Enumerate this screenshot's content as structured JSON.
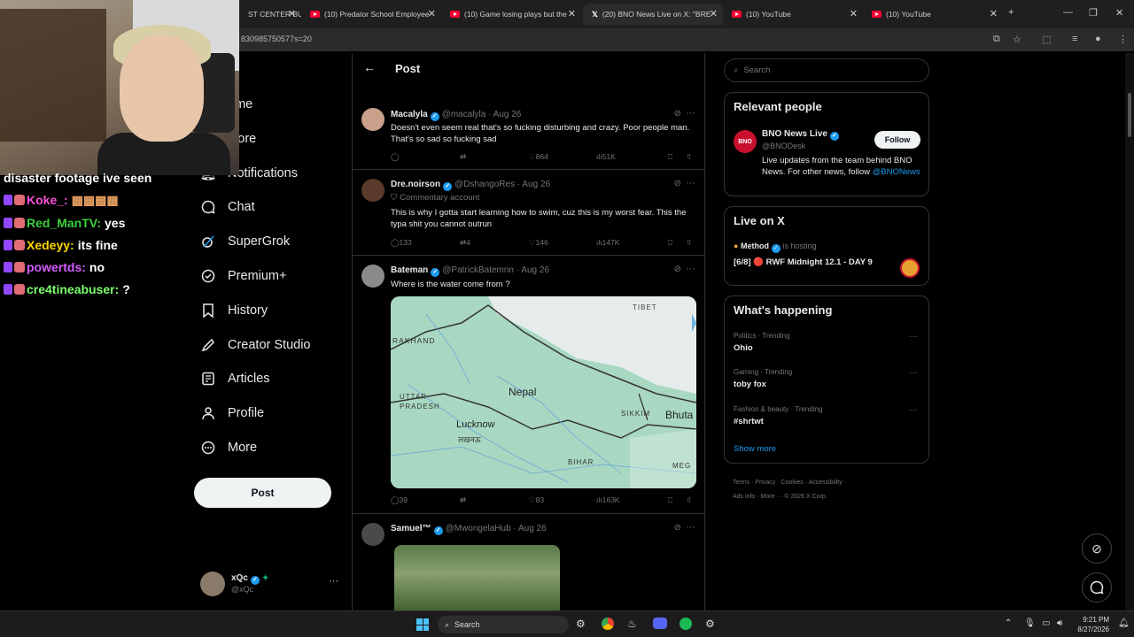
{
  "browser": {
    "tabs": [
      {
        "label": "ST CENTER BU"
      },
      {
        "label": "(10) Predator School Employee"
      },
      {
        "label": "(10) Game losing plays but the"
      },
      {
        "label": "(20) BNO News Live on X: \"BRE"
      },
      {
        "label": "(10) YouTube"
      },
      {
        "label": "(10) YouTube"
      }
    ],
    "url": "830985750577s=20"
  },
  "chat": [
    {
      "user": "disaster footage ive seen",
      "message": "",
      "color": "#ffffff"
    },
    {
      "user": "Koke_:",
      "message": "",
      "color": "#ff4fd8"
    },
    {
      "user": "Red_ManTV:",
      "message": "yes",
      "color": "#3ccf3c"
    },
    {
      "user": "Xedeyy:",
      "message": "its fine",
      "color": "#ffd400"
    },
    {
      "user": "powertds:",
      "message": "no",
      "color": "#d55cff"
    },
    {
      "user": "cre4tineabuser:",
      "message": "?",
      "color": "#7cff6b"
    }
  ],
  "nav": {
    "items": [
      {
        "label": "ome",
        "icon": "home-icon"
      },
      {
        "label": "plore",
        "icon": "explore-icon"
      },
      {
        "label": "Notifications",
        "icon": "bell-icon"
      },
      {
        "label": "Chat",
        "icon": "chat-icon"
      },
      {
        "label": "SuperGrok",
        "icon": "grok-icon"
      },
      {
        "label": "Premium+",
        "icon": "premium-icon"
      },
      {
        "label": "History",
        "icon": "bookmark-icon"
      },
      {
        "label": "Creator Studio",
        "icon": "rocket-icon"
      },
      {
        "label": "Articles",
        "icon": "article-icon"
      },
      {
        "label": "Profile",
        "icon": "profile-icon"
      },
      {
        "label": "More",
        "icon": "more-icon"
      }
    ],
    "post_button": "Post",
    "account": {
      "name": "xQc",
      "handle": "@xQc"
    }
  },
  "main": {
    "header": "Post",
    "tweets": [
      {
        "name": "Macalyla",
        "handle": "@macalyla · Aug 26",
        "text": "Doesn't even seem real that's so fucking disturbing and crazy. Poor people man. That's so sad so fucking sad",
        "replies": "",
        "reposts": "",
        "likes": "864",
        "views": "51K"
      },
      {
        "name": "Dre.noirson",
        "handle": "@DshangoRes · Aug 26",
        "badge": "Commentary account",
        "text": "This is why I gotta start learning how to swim, cuz this is my worst fear. This the typa shit you cannot outrun",
        "replies": "133",
        "reposts": "4",
        "likes": "146",
        "views": "147K"
      },
      {
        "name": "Bateman",
        "handle": "@PatrickBatemnn · Aug 26",
        "text": "Where is the water come from ?",
        "replies": "39",
        "reposts": "",
        "likes": "83",
        "views": "163K"
      },
      {
        "name": "Samuel™",
        "handle": "@MwongelaHub · Aug 26",
        "text": "",
        "replies": "",
        "reposts": "",
        "likes": "",
        "views": ""
      }
    ],
    "map": {
      "labels": [
        "TIBET",
        "RAKHAND",
        "Nepal",
        "UTTAR PRADESH",
        "Lucknow",
        "लखनऊ",
        "SIKKIM",
        "Bhuta",
        "BIHAR",
        "MEG"
      ]
    }
  },
  "right": {
    "search_placeholder": "Search",
    "relevant": {
      "title": "Relevant people",
      "name": "BNO News Live",
      "handle": "@BNODesk",
      "follow": "Follow",
      "bio": "Live updates from the team behind BNO News. For other news, follow",
      "link": "@BNONews"
    },
    "live": {
      "title": "Live on X",
      "host": "Method",
      "hosting": "is hosting",
      "stream": "[6/8] 🔴 RWF Midnight 12.1 - DAY 9"
    },
    "happening": {
      "title": "What's happening",
      "trends": [
        {
          "category": "Politics · Trending",
          "topic": "Ohio"
        },
        {
          "category": "Gaming · Trending",
          "topic": "toby fox"
        },
        {
          "category": "Fashion & beauty · Trending",
          "topic": "#shrtwt"
        }
      ],
      "show_more": "Show more"
    },
    "footer": [
      "Terms",
      "Privacy",
      "Cookies",
      "Accessibility",
      "Ads info",
      "More ···",
      "© 2026 X Corp."
    ]
  },
  "taskbar": {
    "search": "Search",
    "time": "9:21 PM",
    "date": "8/27/2026"
  },
  "colors": {
    "accent": "#1d9bf0",
    "background": "#000000",
    "border": "#2f3336"
  }
}
